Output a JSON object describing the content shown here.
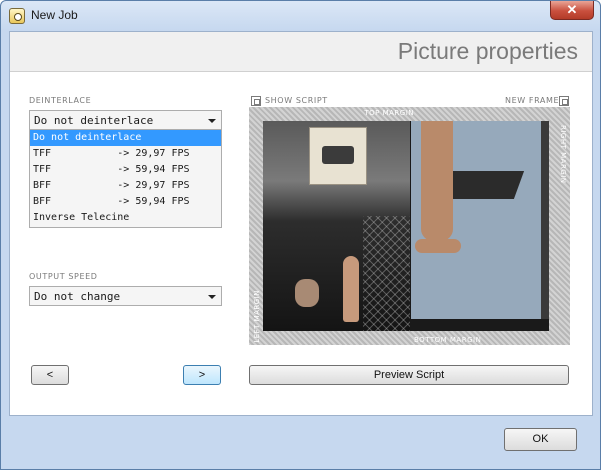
{
  "window": {
    "title": "New Job",
    "close_glyph": "✕"
  },
  "header": {
    "title": "Picture properties"
  },
  "deinterlace": {
    "label": "DEINTERLACE",
    "selected": "Do not deinterlace",
    "options": [
      "Do not deinterlace",
      "TFF           -> 29,97 FPS",
      "TFF           -> 59,94 FPS",
      "BFF           -> 29,97 FPS",
      "BFF           -> 59,94 FPS",
      "Inverse Telecine"
    ],
    "highlighted_index": 0
  },
  "output_speed": {
    "label": "OUTPUT SPEED",
    "selected": "Do not change"
  },
  "preview": {
    "show_script_label": "SHOW SCRIPT",
    "new_frame_label": "NEW FRAME",
    "top_margin": "TOP MARGIN",
    "bottom_margin": "BOTTOM MARGIN",
    "left_margin": "LEFT MARGIN",
    "right_margin": "RIGHT MARGIN"
  },
  "nav": {
    "prev_label": "<",
    "next_label": ">"
  },
  "buttons": {
    "preview_script": "Preview Script",
    "ok": "OK"
  },
  "colors": {
    "selection": "#3399ff",
    "titlebar": "#c6d8ef",
    "close": "#c9503e"
  }
}
